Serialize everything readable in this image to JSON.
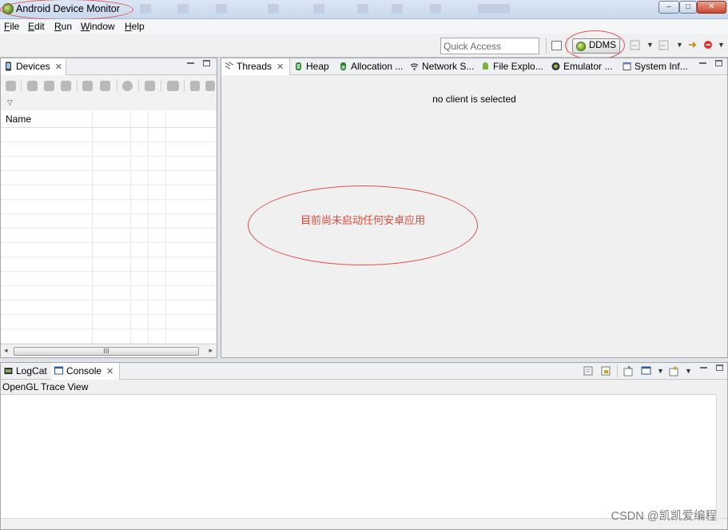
{
  "window": {
    "title": "Android Device Monitor",
    "controls": [
      "–",
      "□",
      "✕"
    ]
  },
  "menu": {
    "items": [
      {
        "mnemonic": "F",
        "rest": "ile"
      },
      {
        "mnemonic": "E",
        "rest": "dit"
      },
      {
        "mnemonic": "R",
        "rest": "un"
      },
      {
        "mnemonic": "W",
        "rest": "indow"
      },
      {
        "mnemonic": "H",
        "rest": "elp"
      }
    ]
  },
  "toolbar": {
    "quick_access_placeholder": "Quick Access",
    "perspective_label": "DDMS"
  },
  "devices_panel": {
    "tab_label": "Devices",
    "close_glyph": "✕",
    "column_name": "Name",
    "scroll_grip": "III"
  },
  "main_panel": {
    "tabs": [
      {
        "label": "Threads"
      },
      {
        "label": "Heap"
      },
      {
        "label": "Allocation ..."
      },
      {
        "label": "Network S..."
      },
      {
        "label": "File Explo..."
      },
      {
        "label": "Emulator ..."
      },
      {
        "label": "System Inf..."
      }
    ],
    "empty_message": "no client is selected",
    "annotation_text": "目前尚未启动任何安卓应用"
  },
  "bottom_panel": {
    "tabs": [
      {
        "label": "LogCat"
      },
      {
        "label": "Console"
      }
    ],
    "view_title": "OpenGL Trace View"
  },
  "watermark": "CSDN @凯凯爱编程",
  "colors": {
    "annotation_red": "#e05050",
    "android_green": "#7cb342"
  }
}
